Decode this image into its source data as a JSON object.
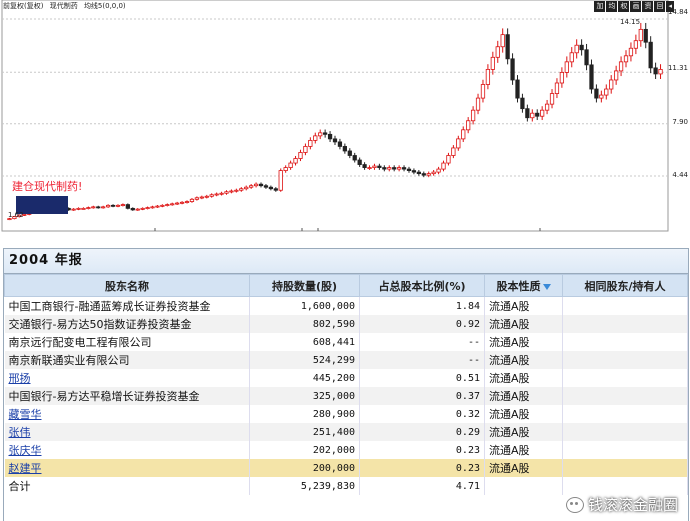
{
  "chart": {
    "header": [
      "前复权(复权)",
      "现代制药",
      "均线5(0,0,0)"
    ],
    "toolbar": [
      "加",
      "均",
      "权",
      "画",
      "资",
      "回",
      "◂"
    ],
    "price_levels": [
      "14.84",
      "11.31",
      "7.90",
      "4.44"
    ],
    "max_label": "14.15",
    "min_label": "1.62",
    "annotation": "建仓现代制药!"
  },
  "chart_data": {
    "type": "candlestick",
    "title": "",
    "y_ticks": [
      4.44,
      7.9,
      11.31,
      14.84
    ],
    "ylim": [
      1.0,
      15.3
    ],
    "max": 14.15,
    "min": 1.62,
    "close_series": [
      1.62,
      1.75,
      1.85,
      1.9,
      2.0,
      2.05,
      2.1,
      2.05,
      2.15,
      2.2,
      2.25,
      2.3,
      2.2,
      2.25,
      2.3,
      2.3,
      2.35,
      2.4,
      2.35,
      2.4,
      2.5,
      2.45,
      2.5,
      2.55,
      2.3,
      2.2,
      2.25,
      2.3,
      2.35,
      2.4,
      2.45,
      2.5,
      2.55,
      2.6,
      2.65,
      2.7,
      2.75,
      2.9,
      3.0,
      3.05,
      3.1,
      3.2,
      3.25,
      3.3,
      3.4,
      3.45,
      3.5,
      3.6,
      3.7,
      3.8,
      3.9,
      3.8,
      3.7,
      3.6,
      3.5,
      4.8,
      5.0,
      5.3,
      5.6,
      6.0,
      6.4,
      6.8,
      7.1,
      7.3,
      7.2,
      6.9,
      6.7,
      6.4,
      6.1,
      5.8,
      5.5,
      5.2,
      5.0,
      5.0,
      5.1,
      5.0,
      4.9,
      5.0,
      4.9,
      5.0,
      4.9,
      4.8,
      4.7,
      4.6,
      4.5,
      4.6,
      4.7,
      4.9,
      5.3,
      5.8,
      6.3,
      6.9,
      7.5,
      8.1,
      8.8,
      9.6,
      10.5,
      11.5,
      12.3,
      13.0,
      13.8,
      12.2,
      10.8,
      9.6,
      8.9,
      8.3,
      8.6,
      8.4,
      8.8,
      9.2,
      9.9,
      10.6,
      11.3,
      12.0,
      12.6,
      13.1,
      12.8,
      11.8,
      10.2,
      9.6,
      9.8,
      10.2,
      10.8,
      11.4,
      12.0,
      12.4,
      12.9,
      13.4,
      14.15,
      13.3,
      11.6,
      11.2,
      11.5
    ]
  },
  "report": {
    "title": "2004 年报",
    "columns": [
      "股东名称",
      "持股数量(股)",
      "占总股本比例(%)",
      "股本性质",
      "相同股东/持有人"
    ],
    "rows": [
      {
        "name": "中国工商银行-融通蓝筹成长证券投资基金",
        "shares": "1,600,000",
        "ratio": "1.84",
        "nature": "流通A股",
        "same": "",
        "link": false
      },
      {
        "name": "交通银行-易方达50指数证券投资基金",
        "shares": "802,590",
        "ratio": "0.92",
        "nature": "流通A股",
        "same": "",
        "link": false
      },
      {
        "name": "南京远行配变电工程有限公司",
        "shares": "608,441",
        "ratio": "--",
        "nature": "流通A股",
        "same": "",
        "link": false
      },
      {
        "name": "南京新联通实业有限公司",
        "shares": "524,299",
        "ratio": "--",
        "nature": "流通A股",
        "same": "",
        "link": false
      },
      {
        "name": "邢扬",
        "shares": "445,200",
        "ratio": "0.51",
        "nature": "流通A股",
        "same": "",
        "link": true
      },
      {
        "name": "中国银行-易方达平稳增长证券投资基金",
        "shares": "325,000",
        "ratio": "0.37",
        "nature": "流通A股",
        "same": "",
        "link": false
      },
      {
        "name": "藏雪华",
        "shares": "280,900",
        "ratio": "0.32",
        "nature": "流通A股",
        "same": "",
        "link": true
      },
      {
        "name": "张伟",
        "shares": "251,400",
        "ratio": "0.29",
        "nature": "流通A股",
        "same": "",
        "link": true
      },
      {
        "name": "张庆华",
        "shares": "202,000",
        "ratio": "0.23",
        "nature": "流通A股",
        "same": "",
        "link": true
      },
      {
        "name": "赵建平",
        "shares": "200,000",
        "ratio": "0.23",
        "nature": "流通A股",
        "same": "",
        "link": true,
        "highlight": true
      },
      {
        "name": "合计",
        "shares": "5,239,830",
        "ratio": "4.71",
        "nature": "",
        "same": "",
        "link": false
      }
    ]
  },
  "watermark": "钱滚滚金融圈",
  "colors": {
    "up": "#d11",
    "down": "#1a2a6b",
    "grid": "#c8c8c8",
    "highlight": "#f4e4a8",
    "header_bg": "#d4e3f3",
    "link": "#1a3fa8"
  }
}
